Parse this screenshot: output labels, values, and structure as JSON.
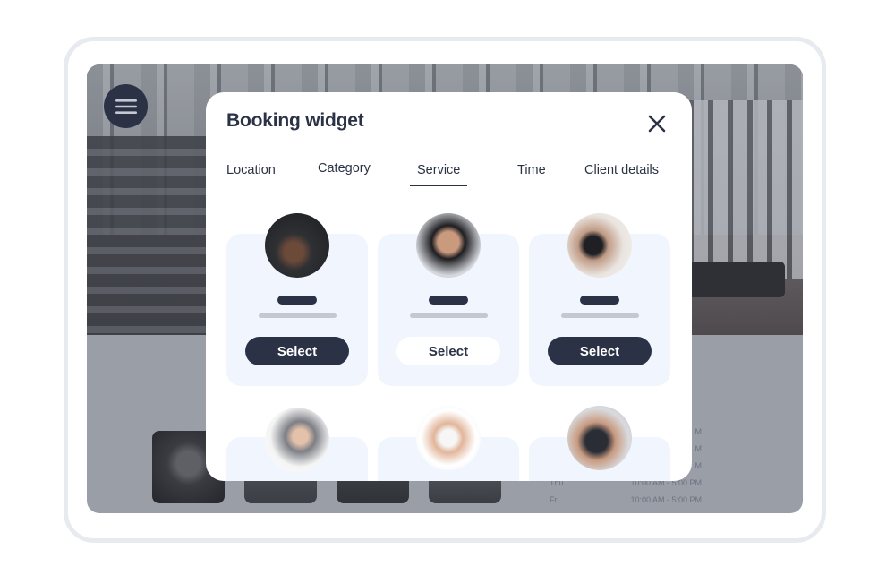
{
  "background_page": {
    "menu_icon": "hamburger-menu-icon",
    "hours": [
      {
        "day": "",
        "time": "M"
      },
      {
        "day": "",
        "time": "M"
      },
      {
        "day": "",
        "time": "M"
      },
      {
        "day": "Thu",
        "time": "10:00 AM - 5:00 PM"
      },
      {
        "day": "Fri",
        "time": "10:00 AM - 5:00 PM"
      }
    ]
  },
  "modal": {
    "title": "Booking widget",
    "close_icon": "close-icon",
    "tabs": [
      {
        "label": "Location",
        "active": false
      },
      {
        "label": "Category",
        "active": false
      },
      {
        "label": "Service",
        "active": true
      },
      {
        "label": "Time",
        "active": false
      },
      {
        "label": "Client details",
        "active": false
      }
    ],
    "services": [
      {
        "image": "kettlebell-training",
        "button_label": "Select",
        "button_style": "dark"
      },
      {
        "image": "woman-sports-bra-back",
        "button_label": "Select",
        "button_style": "light"
      },
      {
        "image": "partner-yoga-stretch",
        "button_label": "Select",
        "button_style": "dark"
      },
      {
        "image": "yoga-backbend",
        "button_label": "",
        "button_style": ""
      },
      {
        "image": "waist-measuring-tape",
        "button_label": "",
        "button_style": ""
      },
      {
        "image": "personal-trainer-client",
        "button_label": "",
        "button_style": ""
      }
    ]
  },
  "colors": {
    "primary_dark": "#2b3246",
    "card_bg": "#f0f5fe",
    "overlay_gray": "#9a9ea7",
    "device_border": "#e7ebf0"
  }
}
